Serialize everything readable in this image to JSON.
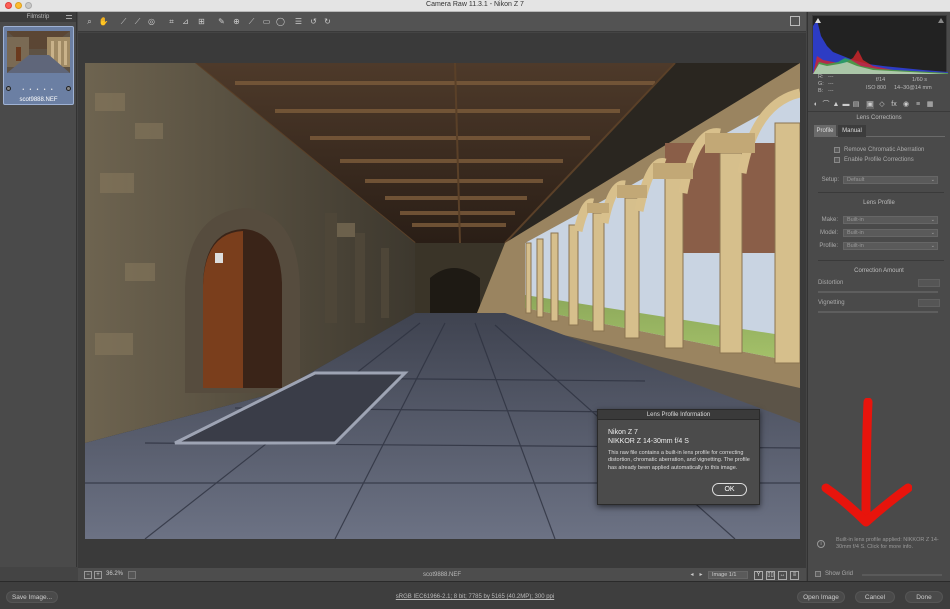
{
  "window": {
    "title": "Camera Raw 11.3.1  -  Nikon Z 7"
  },
  "filmstrip": {
    "header": "Filmstrip",
    "items": [
      {
        "filename": "scot9888.NEF",
        "rating_dots": "• • • • •"
      }
    ]
  },
  "toolbar": {
    "tools": [
      "zoom-icon",
      "hand-icon",
      "white-balance-icon",
      "color-sampler-icon",
      "targeted-adjustment-icon",
      "crop-icon",
      "straighten-icon",
      "transform-icon",
      "spot-removal-icon",
      "red-eye-icon",
      "adjustment-brush-icon",
      "graduated-filter-icon",
      "radial-filter-icon",
      "preferences-icon",
      "rotate-left-icon",
      "rotate-right-icon"
    ]
  },
  "dialog": {
    "title": "Lens Profile Information",
    "camera": "Nikon Z 7",
    "lens": "NIKKOR Z 14-30mm f/4 S",
    "body": "This raw file contains a built-in lens profile for correcting distortion, chromatic aberration, and vignetting. The profile has already been applied automatically to this image.",
    "ok_label": "OK"
  },
  "canvas_status": {
    "zoom_minus": "−",
    "zoom_plus": "+",
    "zoom_value": "36.2%",
    "filename": "scot9888.NEF",
    "image_counter": "Image 1/1",
    "prev_symbol": "◂",
    "next_symbol": "▸",
    "view_toggle": "Y",
    "before_after": "▯▯",
    "swap": "↔",
    "menu": "≡"
  },
  "exif": {
    "r_label": "R:",
    "r_val": "---",
    "g_label": "G:",
    "g_val": "---",
    "b_label": "B:",
    "b_val": "---",
    "aperture": "f/14",
    "shutter": "1/60 s",
    "iso": "ISO 800",
    "focal": "14–30@14 mm"
  },
  "lens_corrections": {
    "section_title": "Lens Corrections",
    "tabs": [
      {
        "label": "Profile",
        "active": true
      },
      {
        "label": "Manual",
        "active": false
      }
    ],
    "remove_ca_label": "Remove Chromatic Aberration",
    "enable_profile_label": "Enable Profile Corrections",
    "setup_label": "Setup:",
    "setup_value": "Default",
    "lens_profile_title": "Lens Profile",
    "make_label": "Make:",
    "make_value": "Built-in",
    "model_label": "Model:",
    "model_value": "Built-in",
    "profile_label": "Profile:",
    "profile_value": "Built-in",
    "correction_amount_title": "Correction Amount",
    "distortion_label": "Distortion",
    "vignetting_label": "Vignetting",
    "info_text": "Built-in lens profile applied: NIKKOR Z 14-30mm f/4 S.  Click for more info.",
    "show_grid_label": "Show Grid"
  },
  "bottom": {
    "save_label": "Save Image...",
    "workflow_link": "sRGB IEC61966-2.1; 8 bit; 7785 by 5165 (40.2MP); 300 ppi",
    "open_label": "Open Image",
    "cancel_label": "Cancel",
    "done_label": "Done"
  },
  "colors": {
    "panel_bg": "#4a4a4a",
    "canvas_bg": "#3a3a3a",
    "annotation_red": "#e8140c",
    "filmstrip_selected": "#6b7fa3"
  }
}
